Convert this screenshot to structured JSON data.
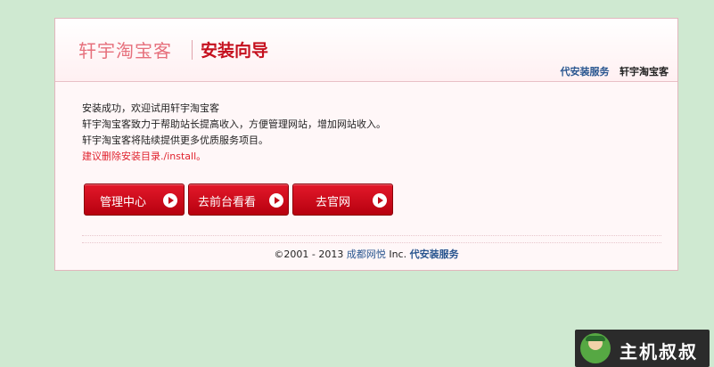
{
  "header": {
    "logo": "轩宇淘宝客",
    "wizard_title": "安装向导",
    "links": {
      "install_service": "代安装服务",
      "site_name": "轩宇淘宝客"
    }
  },
  "content": {
    "line1": "安装成功，欢迎试用轩宇淘宝客",
    "line2": "轩宇淘宝客致力于帮助站长提高收入，方便管理网站，增加网站收入。",
    "line3": "轩宇淘宝客将陆续提供更多优质服务项目。",
    "warning": "建议删除安装目录./install。"
  },
  "buttons": {
    "admin": "管理中心",
    "frontend": "去前台看看",
    "official": "去官网"
  },
  "footer": {
    "copyright": "©2001 - 2013",
    "company": "成都网悦",
    "inc": "Inc.",
    "service": "代安装服务"
  },
  "watermark": {
    "text": "主机叔叔"
  },
  "colors": {
    "background": "#cfe9d1",
    "accent_red": "#c5101e",
    "link_blue": "#28558f"
  }
}
